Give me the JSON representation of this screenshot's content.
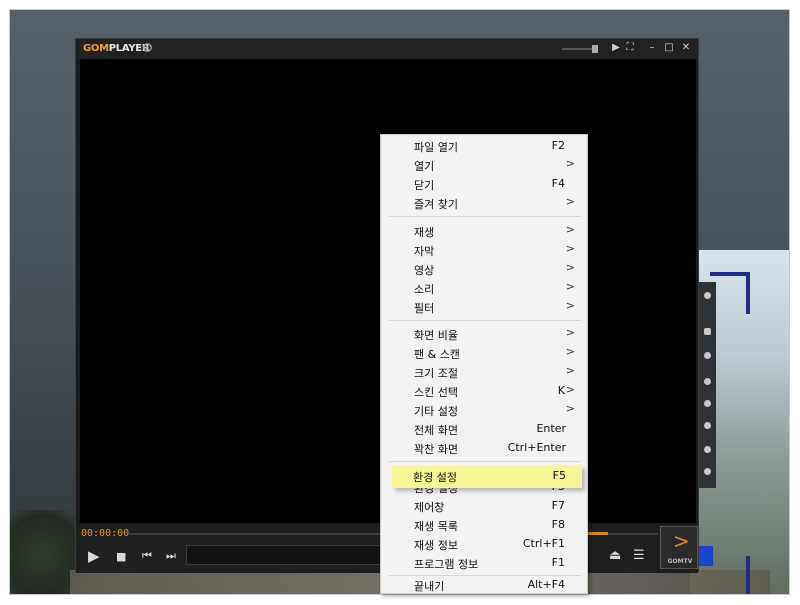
{
  "player": {
    "logo_gom": "GOM",
    "logo_player": "PLAYER",
    "timecode": "00:00:00",
    "gomtv_label": "GOMTV"
  },
  "icons": {
    "play": "▶",
    "stop": "■",
    "prev": "⏮",
    "next": "⏭",
    "eject": "⏏",
    "playlist": "☰",
    "minimize": "–",
    "maximize": "□",
    "close": "✕",
    "pin": "⛶",
    "chevron": ">"
  },
  "menu": {
    "items": [
      {
        "label": "파일 열기",
        "shortcut": "F2",
        "arrow": ""
      },
      {
        "label": "열기",
        "shortcut": "",
        "arrow": ">"
      },
      {
        "label": "닫기",
        "shortcut": "F4",
        "arrow": ""
      },
      {
        "label": "즐겨 찾기",
        "shortcut": "",
        "arrow": ">"
      },
      {
        "label": "재생",
        "shortcut": "",
        "arrow": ">"
      },
      {
        "label": "자막",
        "shortcut": "",
        "arrow": ">"
      },
      {
        "label": "영상",
        "shortcut": "",
        "arrow": ">"
      },
      {
        "label": "소리",
        "shortcut": "",
        "arrow": ">"
      },
      {
        "label": "필터",
        "shortcut": "",
        "arrow": ">"
      },
      {
        "label": "화면 비율",
        "shortcut": "",
        "arrow": ">"
      },
      {
        "label": "팬 & 스캔",
        "shortcut": "",
        "arrow": ">"
      },
      {
        "label": "크기 조절",
        "shortcut": "",
        "arrow": ">"
      },
      {
        "label": "스킨 선택",
        "shortcut": "K",
        "arrow": ">"
      },
      {
        "label": "기타 설정",
        "shortcut": "",
        "arrow": ">"
      },
      {
        "label": "전체 화면",
        "shortcut": "Enter",
        "arrow": ""
      },
      {
        "label": "꽉찬 화면",
        "shortcut": "Ctrl+Enter",
        "arrow": ""
      },
      {
        "label": "환경 설정",
        "shortcut": "F5",
        "arrow": ""
      },
      {
        "label": "제어창",
        "shortcut": "F7",
        "arrow": ""
      },
      {
        "label": "재생 목록",
        "shortcut": "F8",
        "arrow": ""
      },
      {
        "label": "재생 정보",
        "shortcut": "Ctrl+F1",
        "arrow": ""
      },
      {
        "label": "프로그램 정보",
        "shortcut": "F1",
        "arrow": ""
      },
      {
        "label": "끝내기",
        "shortcut": "Alt+F4",
        "arrow": ""
      }
    ],
    "highlighted_index": 16
  },
  "colors": {
    "accent": "#e39a2d",
    "highlight": "#f7f7a6",
    "menu_bg": "#f2f2f2"
  }
}
